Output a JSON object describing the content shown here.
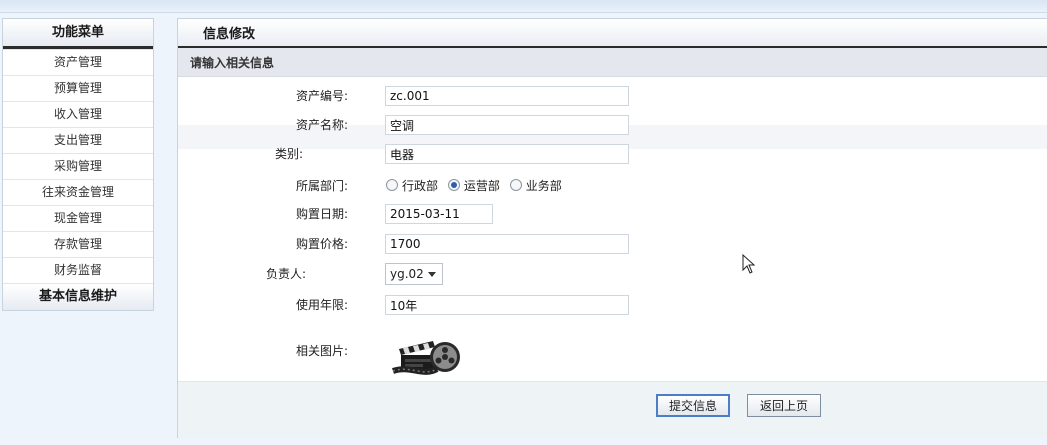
{
  "sidebar": {
    "title": "功能菜单",
    "items": [
      {
        "label": "资产管理"
      },
      {
        "label": "预算管理"
      },
      {
        "label": "收入管理"
      },
      {
        "label": "支出管理"
      },
      {
        "label": "采购管理"
      },
      {
        "label": "往来资金管理"
      },
      {
        "label": "现金管理"
      },
      {
        "label": "存款管理"
      },
      {
        "label": "财务监督"
      }
    ],
    "footer": "基本信息维护"
  },
  "main": {
    "title": "信息修改",
    "section": "请输入相关信息",
    "form": {
      "asset_no": {
        "label": "资产编号:",
        "value": "zc.001"
      },
      "asset_name": {
        "label": "资产名称:",
        "value": "空调"
      },
      "category": {
        "label": "类别:",
        "value": "电器"
      },
      "department": {
        "label": "所属部门:",
        "options": [
          "行政部",
          "运营部",
          "业务部"
        ],
        "selected": "运营部"
      },
      "purchase_date": {
        "label": "购置日期:",
        "value": "2015-03-11"
      },
      "purchase_price": {
        "label": "购置价格:",
        "value": "1700"
      },
      "owner": {
        "label": "负责人:",
        "value": "yg.02"
      },
      "service_life": {
        "label": "使用年限:",
        "value": "10年"
      },
      "photo": {
        "label": "相关图片:",
        "icon": "film-reel-icon"
      }
    },
    "buttons": {
      "submit": "提交信息",
      "back": "返回上页"
    }
  },
  "colors": {
    "background": "#eef4fb",
    "accent": "#2b5fb0",
    "header_rule": "#2b2b2b"
  }
}
